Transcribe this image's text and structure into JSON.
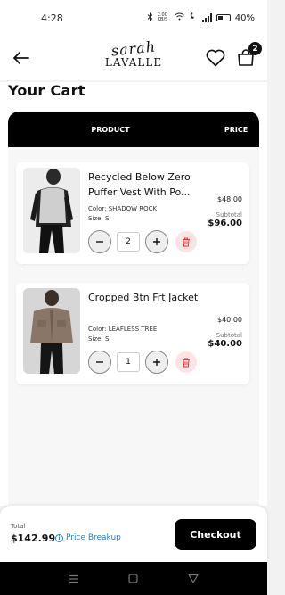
{
  "status_bar": {
    "time": "4:28",
    "data_speed": "2.00 KB/S",
    "battery": "40%"
  },
  "header": {
    "logo_script": "sarah",
    "logo_caps": "LAVALLE",
    "cart_count": "2",
    "icons": [
      "back-arrow-icon",
      "heart-icon",
      "shopping-bag-icon"
    ]
  },
  "page": {
    "title": "Your Cart"
  },
  "table": {
    "col_product": "PRODUCT",
    "col_price": "PRICE"
  },
  "items": [
    {
      "name": "Recycled Below Zero Puffer Vest With Po...",
      "color": "Color: SHADOW ROCK",
      "size": "Size: S",
      "price": "$48.00",
      "subtotal_label": "Subtotal",
      "subtotal": "$96.00",
      "quantity": "2"
    },
    {
      "name": "Cropped Btn Frt Jacket",
      "color": "Color: LEAFLESS TREE",
      "size": "Size: S",
      "price": "$40.00",
      "subtotal_label": "Subtotal",
      "subtotal": "$40.00",
      "quantity": "1"
    }
  ],
  "footer": {
    "total_label": "Total",
    "total": "$142.99",
    "breakup_label": "Price Breakup",
    "checkout_label": "Checkout"
  },
  "colors": {
    "accent_link": "#2e7dd7",
    "delete_bg": "#fde3e3",
    "delete_icon": "#e53935",
    "primary": "#000000"
  }
}
